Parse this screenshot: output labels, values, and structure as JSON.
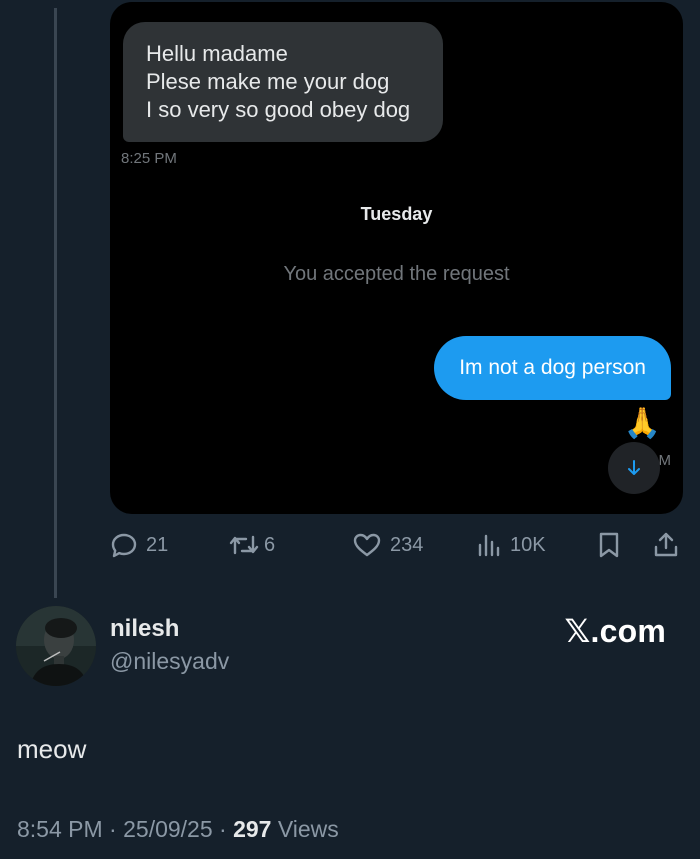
{
  "dm": {
    "incoming_lines": [
      "Hellu madame",
      "Plese make me your dog",
      "I so very so good obey dog"
    ],
    "incoming_time": "8:25 PM",
    "day_separator": "Tuesday",
    "system_message": "You accepted the request",
    "outgoing_message": "Im not a dog person",
    "reaction_emoji": "🙏",
    "outgoing_time_fragment": "M"
  },
  "actions": {
    "replies": "21",
    "retweets": "6",
    "likes": "234",
    "views": "10K"
  },
  "author": {
    "name": "nilesh",
    "handle": "@nilesyadv"
  },
  "brand": "𝕏.com",
  "tweet": {
    "text": "meow",
    "time": "8:54 PM",
    "date": "25/09/25",
    "views_count": "297",
    "views_label": "Views"
  },
  "colors": {
    "background": "#15202b",
    "card": "#000000",
    "incoming_bubble": "#2f3336",
    "outgoing_bubble": "#1d9bf0",
    "muted": "#8b98a5"
  }
}
